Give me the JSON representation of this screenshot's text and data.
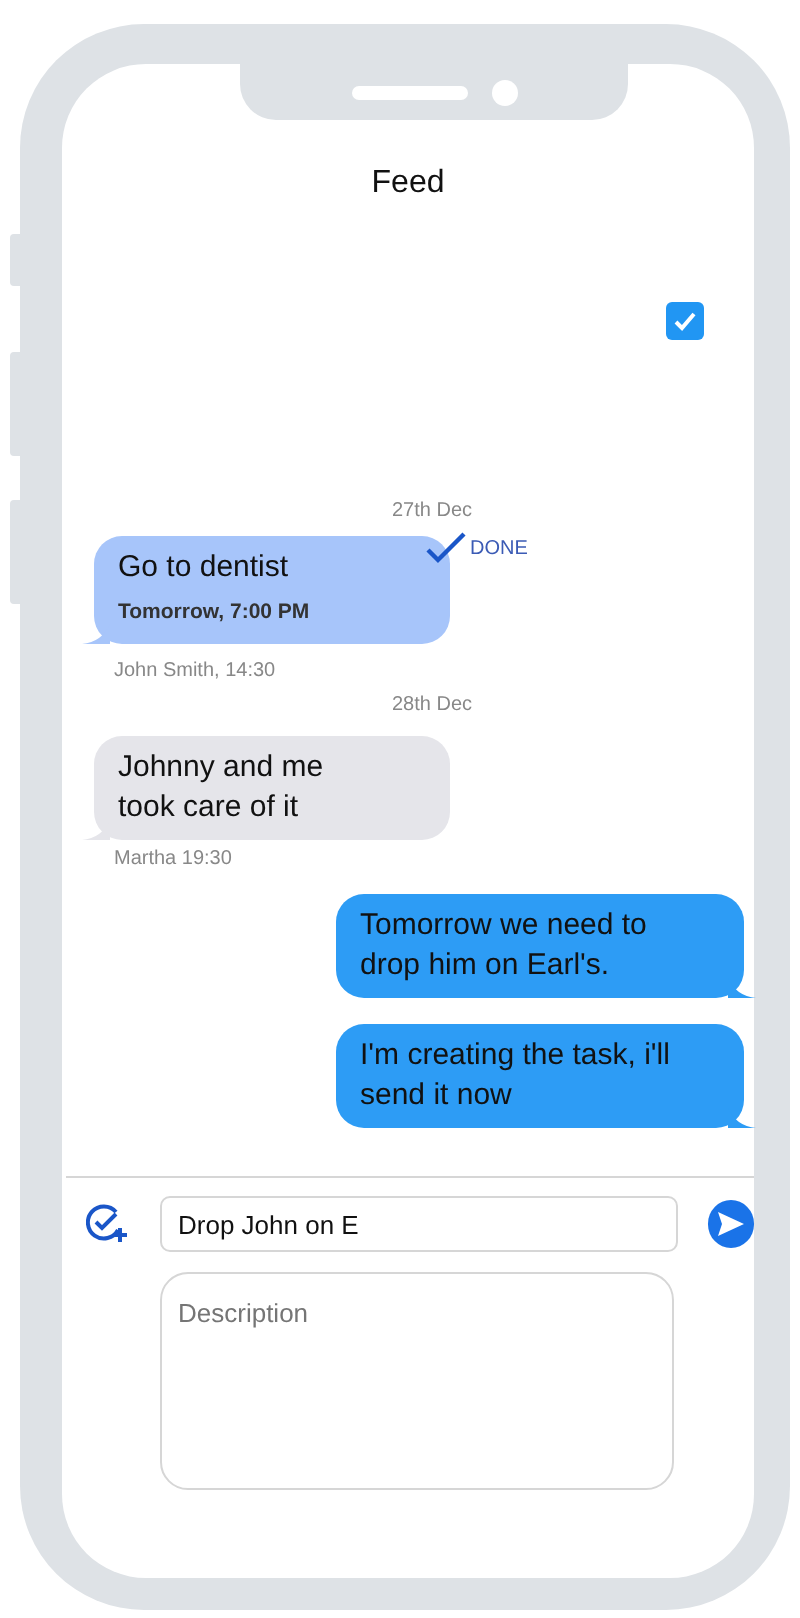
{
  "header": {
    "title": "Feed"
  },
  "filter": {
    "checked": true
  },
  "feed": [
    {
      "kind": "date",
      "text": "27th Dec"
    },
    {
      "kind": "task",
      "title": "Go to dentist",
      "due": "Tomorrow, 7:00 PM",
      "status": "DONE",
      "done": true
    },
    {
      "kind": "meta",
      "text": "John Smith, 14:30"
    },
    {
      "kind": "date",
      "text": "28th Dec"
    },
    {
      "kind": "incoming",
      "text": "Johnny and me took care of it"
    },
    {
      "kind": "meta",
      "text": "Martha 19:30"
    },
    {
      "kind": "outgoing",
      "text": "Tomorrow we need to drop him on Earl's."
    },
    {
      "kind": "outgoing",
      "text": "I'm creating the task, i'll send it now"
    }
  ],
  "composer": {
    "value": "Drop John on E",
    "description_placeholder": "Description"
  }
}
